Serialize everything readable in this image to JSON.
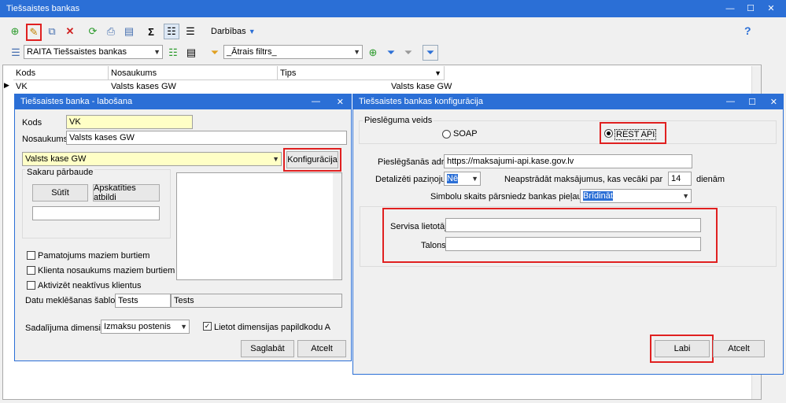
{
  "main": {
    "title": "Tiešsaistes bankas",
    "actions_label": "Darbības",
    "help": "?",
    "filter_select": "RAITA Tiešsaistes bankas",
    "quick_filter": "_Ātrais filtrs_",
    "columns": [
      "Kods",
      "Nosaukums",
      "Tips"
    ],
    "row": {
      "kods": "VK",
      "nosaukums": "Valsts kases GW",
      "tips": "Valsts kase GW"
    }
  },
  "edit": {
    "title": "Tiešsaistes banka - labošana",
    "kods_label": "Kods",
    "kods_value": "VK",
    "nosaukums_label": "Nosaukums",
    "nosaukums_value": "Valsts kases GW",
    "type_value": "Valsts kase GW",
    "config_button": "Konfigurācija",
    "sakaru_title": "Sakaru pārbaude",
    "send_button": "Sūtīt",
    "view_button": "Apskatīties atbildi",
    "cb1": "Pamatojums maziem burtiem",
    "cb2": "Klienta nosaukums maziem burtiem",
    "cb3": "Aktivizēt neaktīvus klientus",
    "pattern_label": "Datu meklēšanas šablons:",
    "pattern_value": "Tests",
    "pattern_value2": "Tests",
    "dim_label": "Sadalījuma dimensija:",
    "dim_value": "Izmaksu postenis",
    "dim_cb": "Lietot dimensijas papildkodu A",
    "save_button": "Saglabāt",
    "cancel_button": "Atcelt"
  },
  "config": {
    "title": "Tiešsaistes bankas konfigurācija",
    "conn_title": "Pieslēguma veids",
    "soap": "SOAP",
    "rest": "REST API",
    "login_label": "Pieslēgšanās adrese",
    "login_value": "https://maksajumi-api.kase.gov.lv",
    "detail_label": "Detalizēti paziņojumi",
    "detail_value": "Nē",
    "old_label": "Neapstrādāt maksājumus, kas vecāki par",
    "old_value": "14",
    "old_unit": "dienām",
    "symbol_label": "Simbolu skaits pārsniedz bankas pieļaujamo",
    "symbol_value": "Brīdināt",
    "user_label": "Servisa lietotājs",
    "user_value": "",
    "token_label": "Talons",
    "token_value": "",
    "ok_button": "Labi",
    "cancel_button": "Atcelt"
  }
}
